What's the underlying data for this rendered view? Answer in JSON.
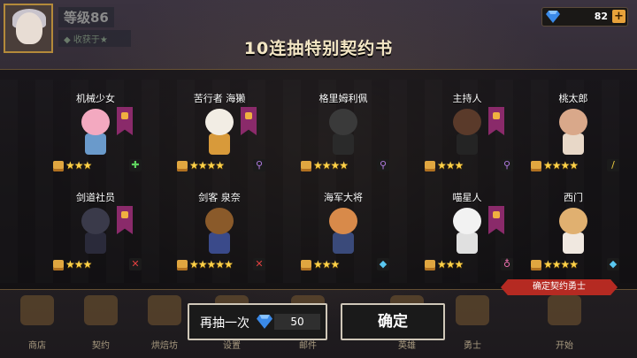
{
  "header": {
    "player_name": "等级86",
    "player_sub": "◆ 收获于★",
    "gems": "82",
    "plus_label": "+",
    "title": "10连抽特别契约书"
  },
  "colors": {
    "accent_gold": "#ffd24a",
    "ribbon_purple": "#8a2a6a",
    "tag_red": "#b52a22"
  },
  "results": [
    {
      "name": "机械少女",
      "stars": "★★★",
      "class_icon": "green-cross-icon",
      "head": "#f3a9c0",
      "body": "#6a9acb",
      "ribbon": true
    },
    {
      "name": "苦行者 海獭",
      "stars": "★★★★",
      "class_icon": "purple-staff-icon",
      "head": "#f2ede4",
      "body": "#d89a3a",
      "ribbon": true
    },
    {
      "name": "格里姆利佩",
      "stars": "★★★★",
      "class_icon": "purple-staff-icon",
      "head": "#3a3a3a",
      "body": "#2a2a2a",
      "ribbon": false
    },
    {
      "name": "主持人",
      "stars": "★★★",
      "class_icon": "purple-staff-icon",
      "head": "#5a3a2a",
      "body": "#242424",
      "ribbon": true
    },
    {
      "name": "桃太郎",
      "stars": "★★★★",
      "class_icon": "yellow-sword-icon",
      "head": "#d9a88a",
      "body": "#e8d8c8",
      "ribbon": false
    },
    {
      "name": "剑道社员",
      "stars": "★★★",
      "class_icon": "red-sword-icon",
      "head": "#3a3a4a",
      "body": "#2a2a3a",
      "ribbon": true
    },
    {
      "name": "剑客 泉奈",
      "stars": "★★★★★",
      "class_icon": "red-sword-icon",
      "head": "#8a5a2a",
      "body": "#3a4a8a",
      "ribbon": false
    },
    {
      "name": "海军大将",
      "stars": "★★★",
      "class_icon": "blue-gun-icon",
      "head": "#d88a4a",
      "body": "#3a4a7a",
      "ribbon": false
    },
    {
      "name": "喵星人",
      "stars": "★★★",
      "class_icon": "pink-ring-icon",
      "head": "#f2f2f2",
      "body": "#e0e0e0",
      "ribbon": true
    },
    {
      "name": "西门",
      "stars": "★★★★",
      "class_icon": "blue-gun-icon",
      "head": "#e0b070",
      "body": "#f0e8e0",
      "ribbon": false
    }
  ],
  "confirm_tag": "确定契约勇士",
  "bottom_nav": [
    {
      "label": "商店",
      "icon": "shop-icon"
    },
    {
      "label": "契约",
      "icon": "contract-icon"
    },
    {
      "label": "烘焙坊",
      "icon": "bakery-icon"
    },
    {
      "label": "设置",
      "icon": "settings-icon"
    },
    {
      "label": "邮件",
      "icon": "mail-icon"
    },
    {
      "label": "英雄",
      "icon": "hero-icon"
    },
    {
      "label": "勇士",
      "icon": "warrior-icon"
    },
    {
      "label": "开始",
      "icon": "start-icon"
    }
  ],
  "actions": {
    "again_label": "再抽一次",
    "again_cost": "50",
    "ok_label": "确定"
  }
}
